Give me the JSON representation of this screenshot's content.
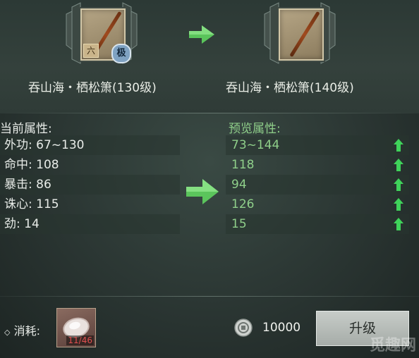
{
  "current_item": {
    "name": "吞山海・栖松箫(130级)",
    "badge_left": "六",
    "badge_right": "极"
  },
  "preview_item": {
    "name": "吞山海・栖松箫(140级)"
  },
  "current_stats": {
    "header": "当前属性:",
    "rows": [
      {
        "label": "外功: 67~130"
      },
      {
        "label": "命中: 108"
      },
      {
        "label": "暴击: 86"
      },
      {
        "label": "诛心: 115"
      },
      {
        "label": "劲: 14"
      }
    ]
  },
  "preview_stats": {
    "header": "预览属性:",
    "rows": [
      {
        "value": "73~144"
      },
      {
        "value": "118"
      },
      {
        "value": "94"
      },
      {
        "value": "126"
      },
      {
        "value": "15"
      }
    ]
  },
  "cost": {
    "label": "消耗:",
    "material_count": "11/46",
    "coin_amount": "10000"
  },
  "upgrade_button": {
    "label": "升级"
  },
  "watermark": "觅趣网",
  "colors": {
    "preview_green": "#8fcf8a",
    "arrow_green": "#5fd35f"
  }
}
